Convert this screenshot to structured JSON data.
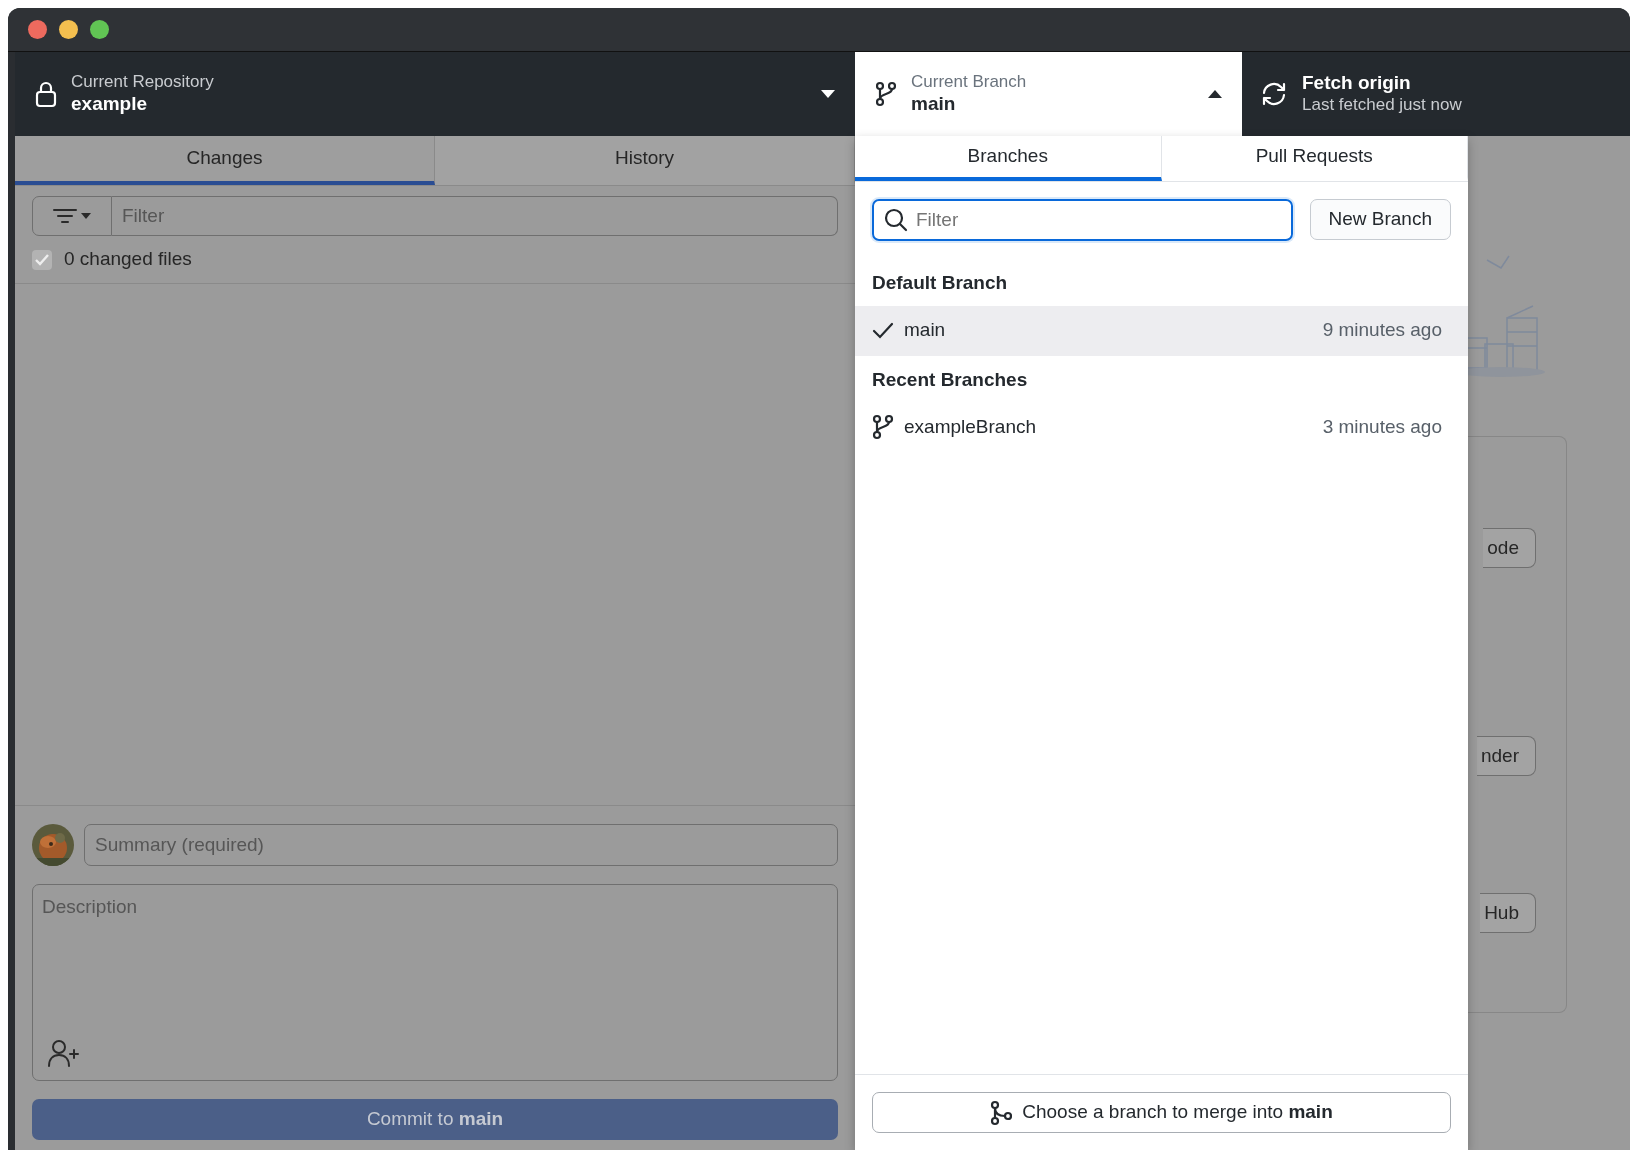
{
  "window": {
    "controls": [
      {
        "kind": "close"
      },
      {
        "kind": "minimize"
      },
      {
        "kind": "zoom"
      }
    ]
  },
  "toolbar": {
    "repository": {
      "label": "Current Repository",
      "name": "example"
    },
    "branch": {
      "label": "Current Branch",
      "name": "main",
      "expanded": true
    },
    "fetch": {
      "title": "Fetch origin",
      "subtitle": "Last fetched just now"
    }
  },
  "changes_panel": {
    "tabs": [
      {
        "label": "Changes",
        "selected": true
      },
      {
        "label": "History",
        "selected": false
      }
    ],
    "filter": {
      "placeholder": "Filter"
    },
    "changed_files": {
      "label": "0 changed files",
      "checked": true
    },
    "summary": {
      "placeholder": "Summary (required)"
    },
    "description": {
      "placeholder": "Description"
    },
    "commit_button": {
      "text": "Commit to **main**",
      "disabled": true
    }
  },
  "branch_dropdown": {
    "tabs": [
      {
        "label": "Branches",
        "selected": true
      },
      {
        "label": "Pull Requests",
        "selected": false
      }
    ],
    "filter": {
      "placeholder": "Filter"
    },
    "new_branch_button": "New Branch",
    "groups": [
      {
        "header": "Default Branch",
        "branches": [
          {
            "name": "main",
            "time": "9 minutes ago",
            "current": true
          }
        ]
      },
      {
        "header": "Recent Branches",
        "branches": [
          {
            "name": "exampleBranch",
            "time": "3 minutes ago",
            "current": false
          }
        ]
      }
    ],
    "merge_button": "Choose a branch to merge into **main**"
  },
  "background": {
    "buttons": [
      "ode",
      "nder",
      "Hub"
    ]
  }
}
